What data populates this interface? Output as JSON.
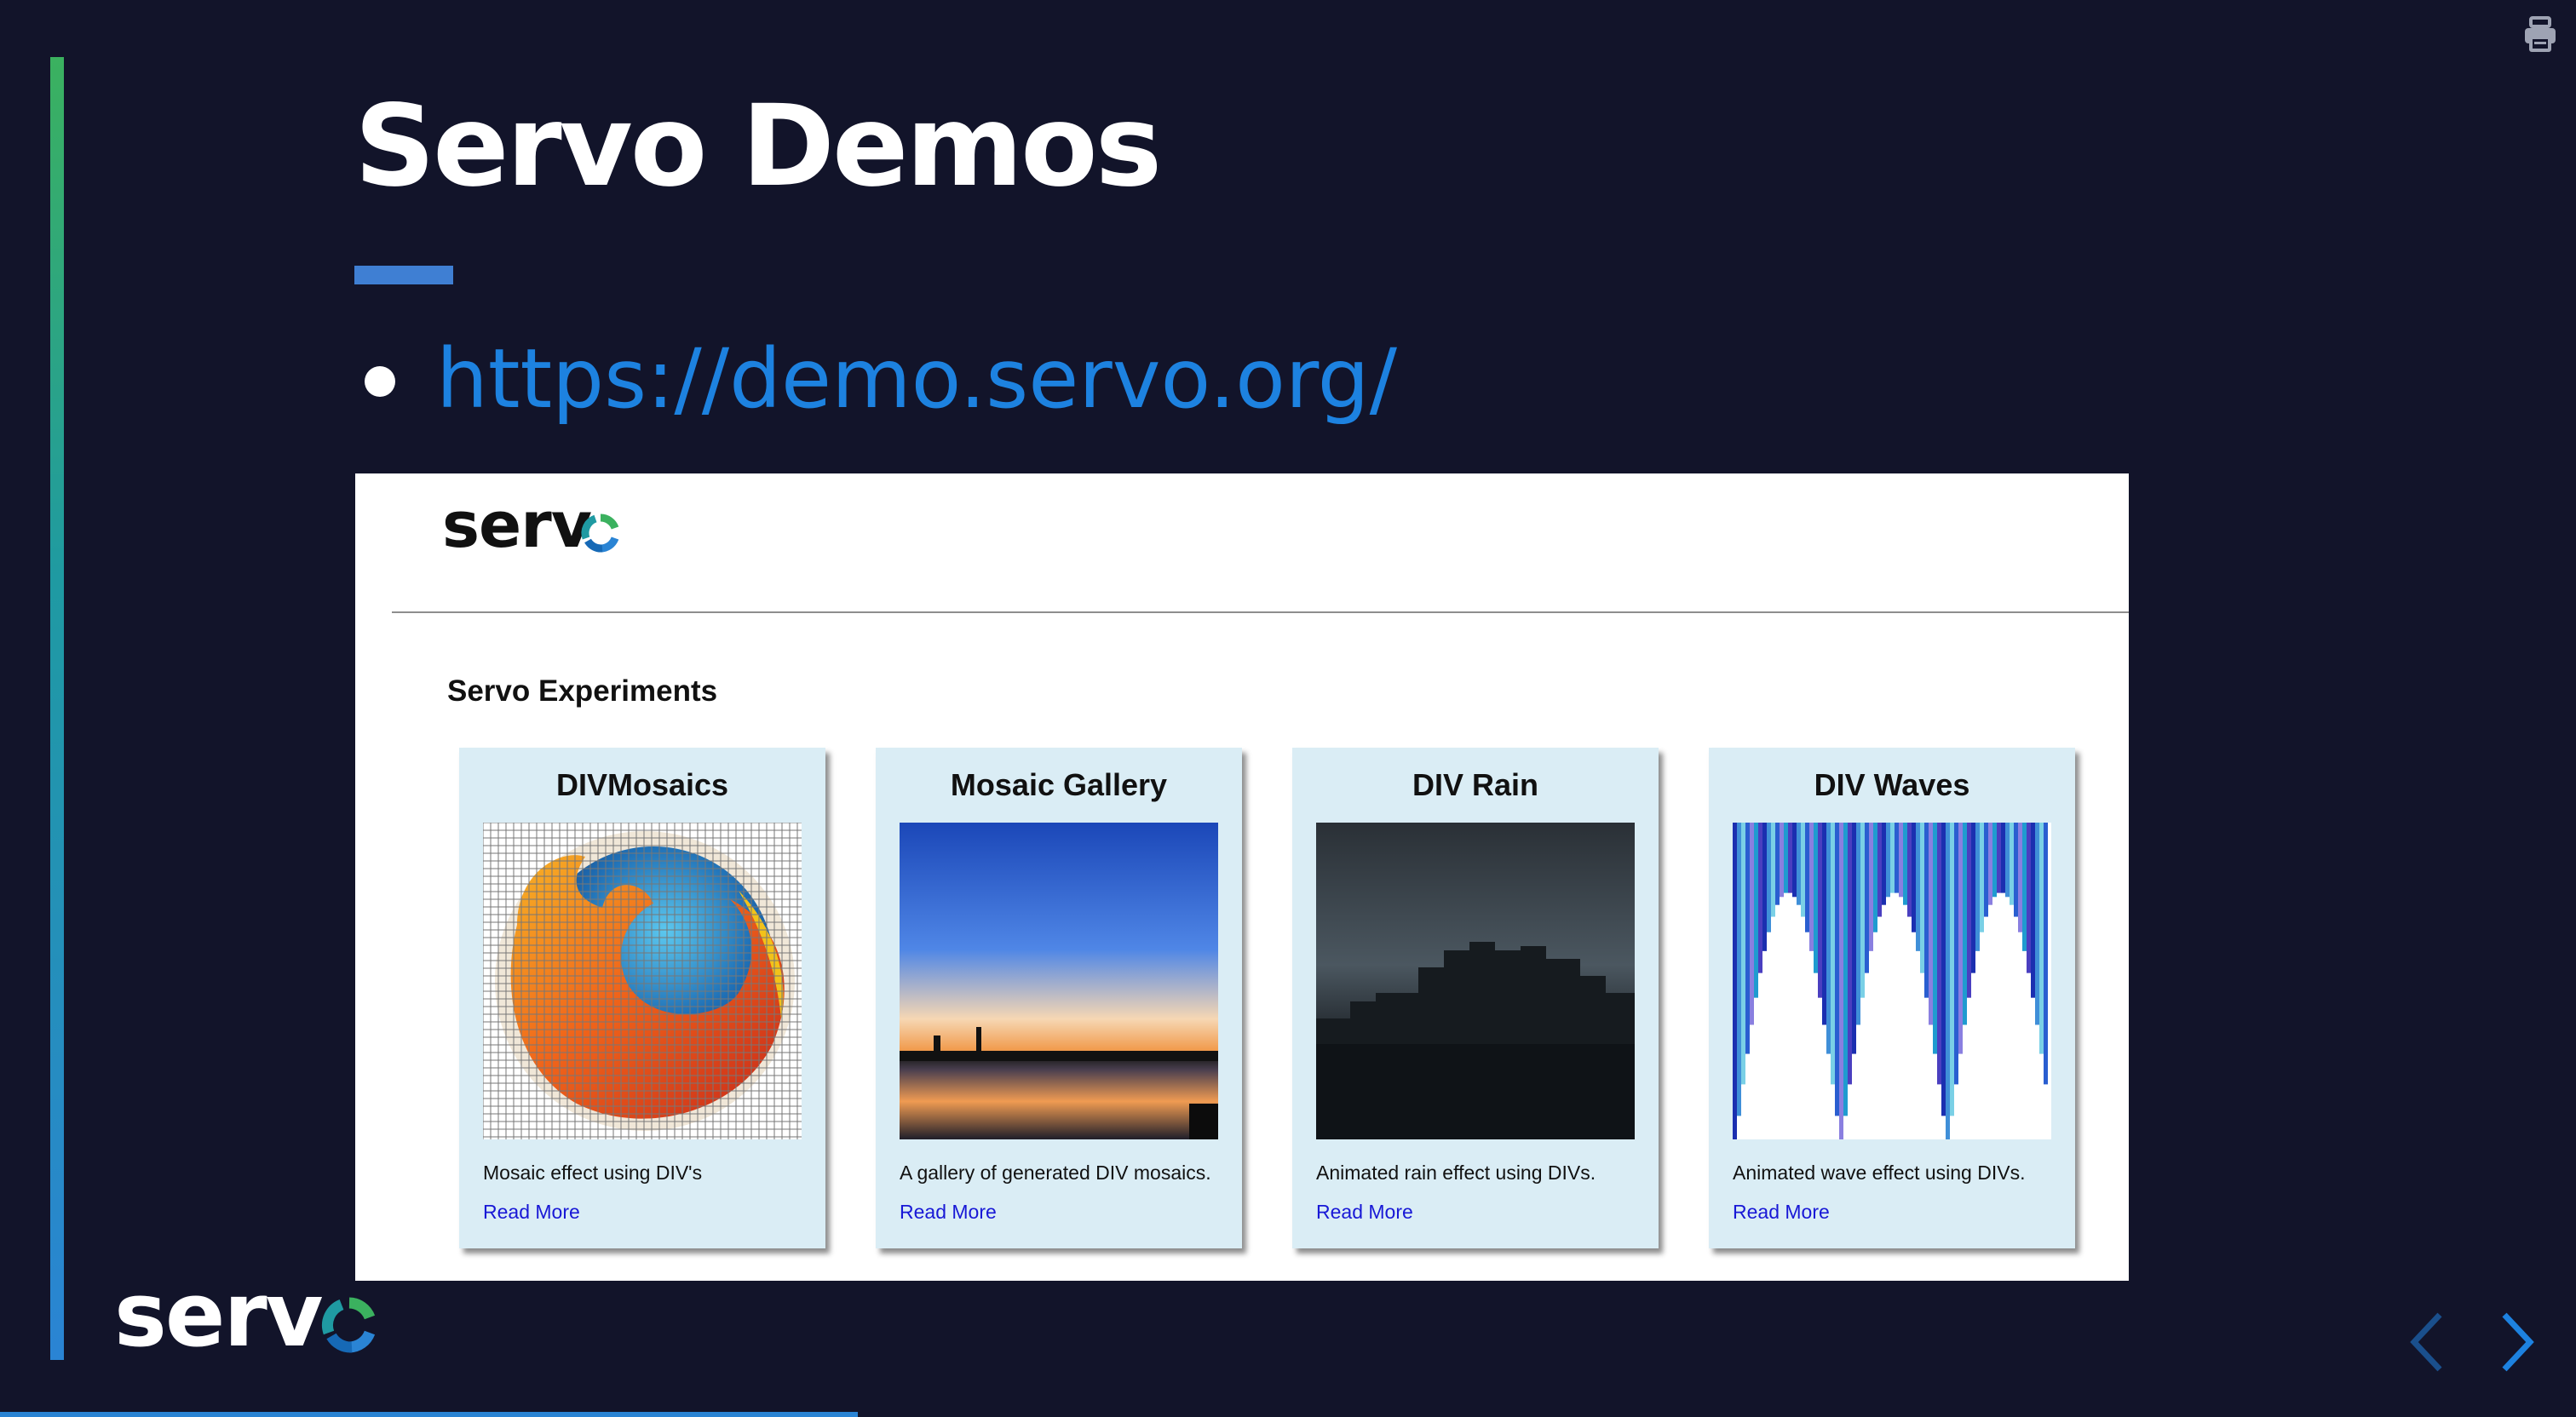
{
  "slide": {
    "title": "Servo Demos",
    "bullet_link": "https://demo.servo.org/",
    "progress_fraction": 0.333
  },
  "logo": {
    "text": "serv"
  },
  "demo_page": {
    "section_heading": "Servo Experiments",
    "cards": [
      {
        "title": "DIVMosaics",
        "description": "Mosaic effect using DIV's",
        "link": "Read More",
        "thumbnail": "firefox-mosaic-image"
      },
      {
        "title": "Mosaic Gallery",
        "description": "A gallery of generated DIV mosaics.",
        "link": "Read More",
        "thumbnail": "sunset-mosaic-image"
      },
      {
        "title": "DIV Rain",
        "description": "Animated rain effect using DIVs.",
        "link": "Read More",
        "thumbnail": "rainy-city-image"
      },
      {
        "title": "DIV Waves",
        "description": "Animated wave effect using DIVs.",
        "link": "Read More",
        "thumbnail": "wave-bars-image"
      }
    ]
  },
  "icons": {
    "print": "printer-icon",
    "prev": "chevron-left-icon",
    "next": "chevron-right-icon"
  },
  "colors": {
    "background": "#12142a",
    "link": "#1d82e0",
    "accent_green": "#3bb15f",
    "accent_blue": "#2a84d4",
    "card_bg": "#daedf5",
    "card_link": "#1818d6"
  }
}
